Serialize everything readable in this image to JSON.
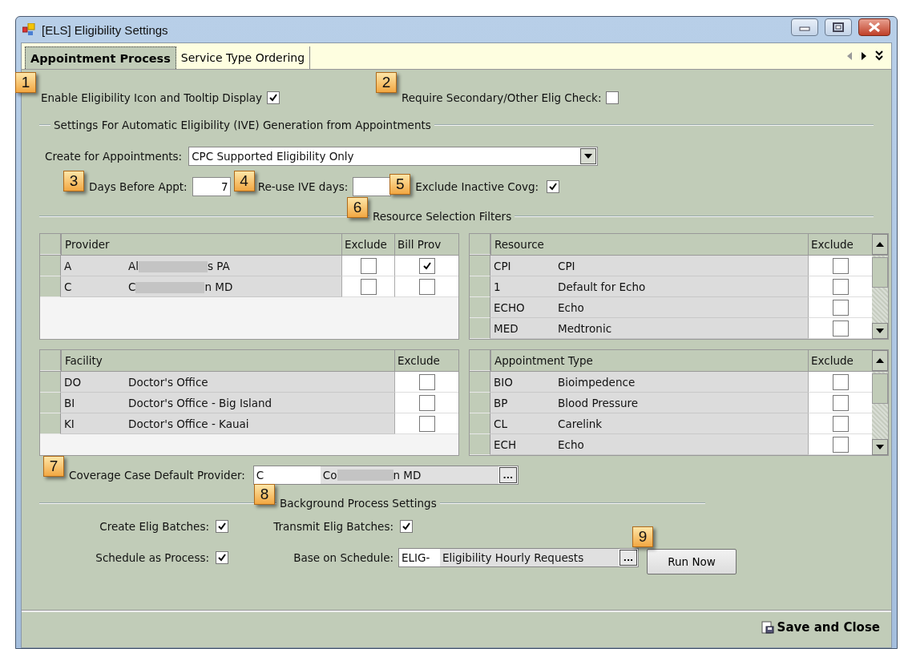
{
  "window": {
    "title": "[ELS] Eligibility Settings"
  },
  "tabs": [
    {
      "label": "Appointment Process",
      "selected": true
    },
    {
      "label": "Service Type Ordering",
      "selected": false
    }
  ],
  "top_options": [
    {
      "label": "Enable Eligibility Icon and Tooltip Display",
      "checked": true,
      "callout": "1"
    },
    {
      "label": "Require Secondary/Other Elig Check:",
      "checked": false,
      "callout": "2"
    }
  ],
  "auto_section": {
    "title": "Settings For Automatic Eligibility (IVE) Generation from Appointments",
    "create_for": {
      "label": "Create for Appointments:",
      "value": "CPC Supported Eligibility Only"
    },
    "days_before": {
      "label": "Days Before Appt:",
      "value": "7",
      "callout": "3"
    },
    "reuse_days": {
      "label": "Re-use IVE days:",
      "callout": "4"
    },
    "exclude_inactive": {
      "label": "Exclude Inactive Covg:",
      "checked": true,
      "callout": "5"
    }
  },
  "filters": {
    "title": "Resource Selection Filters",
    "callout": "6",
    "grids": [
      {
        "columns": [
          "Provider",
          "Exclude",
          "Bill Prov"
        ],
        "scrollable": false,
        "rows": [
          {
            "code": "A",
            "name_parts": [
              "Al",
              "s PA"
            ],
            "checks": [
              false,
              true
            ]
          },
          {
            "code": "C",
            "name_parts": [
              "C",
              "n MD"
            ],
            "checks": [
              false,
              false
            ]
          }
        ]
      },
      {
        "columns": [
          "Resource",
          "Exclude"
        ],
        "scrollable": true,
        "rows": [
          {
            "code": "CPI",
            "name_parts": [
              "CPI"
            ],
            "checks": [
              false
            ]
          },
          {
            "code": "1",
            "name_parts": [
              "Default for Echo"
            ],
            "checks": [
              false
            ]
          },
          {
            "code": "ECHO",
            "name_parts": [
              "Echo"
            ],
            "checks": [
              false
            ]
          },
          {
            "code": "MED",
            "name_parts": [
              "Medtronic"
            ],
            "checks": [
              false
            ]
          }
        ]
      },
      {
        "columns": [
          "Facility",
          "Exclude"
        ],
        "scrollable": false,
        "rows": [
          {
            "code": "DO",
            "name_parts": [
              "Doctor's Office"
            ],
            "checks": [
              false
            ]
          },
          {
            "code": "BI",
            "name_parts": [
              "Doctor's Office - Big Island"
            ],
            "checks": [
              false
            ]
          },
          {
            "code": "KI",
            "name_parts": [
              "Doctor's Office - Kauai"
            ],
            "checks": [
              false
            ]
          }
        ]
      },
      {
        "columns": [
          "Appointment Type",
          "Exclude"
        ],
        "scrollable": true,
        "rows": [
          {
            "code": "BIO",
            "name_parts": [
              "Bioimpedence"
            ],
            "checks": [
              false
            ]
          },
          {
            "code": "BP",
            "name_parts": [
              "Blood Pressure"
            ],
            "checks": [
              false
            ]
          },
          {
            "code": "CL",
            "name_parts": [
              "Carelink"
            ],
            "checks": [
              false
            ]
          },
          {
            "code": "ECH",
            "name_parts": [
              "Echo"
            ],
            "checks": [
              false
            ]
          }
        ]
      }
    ]
  },
  "coverage_provider": {
    "label": "Coverage Case Default Provider:",
    "code": "C",
    "name_parts": [
      "Co",
      "n MD"
    ],
    "browse": "...",
    "callout": "7"
  },
  "background": {
    "title": "Background Process Settings",
    "callout": "8",
    "options": [
      {
        "label": "Create Elig Batches:",
        "checked": true
      },
      {
        "label": "Transmit Elig Batches:",
        "checked": true
      },
      {
        "label": "Schedule as Process:",
        "checked": true
      }
    ],
    "schedule": {
      "label": "Base on Schedule:",
      "code": "ELIG-",
      "name": "Eligibility Hourly Requests",
      "browse": "..."
    },
    "run_button": {
      "label": "Run Now",
      "callout": "9"
    }
  },
  "footer": {
    "save_button": "Save and Close"
  }
}
